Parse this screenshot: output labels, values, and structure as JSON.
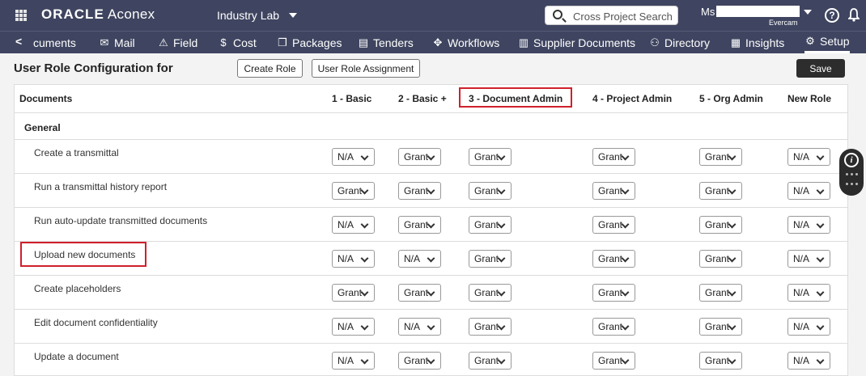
{
  "topbar": {
    "logo_brand": "ORACLE",
    "logo_product": "Aconex",
    "project": "Industry Lab",
    "search_placeholder": "Cross Project Search",
    "user_salutation": "Ms",
    "user_org": "Evercam",
    "help_label": "?"
  },
  "nav": {
    "items": [
      {
        "label": "cuments",
        "icon": "documents-icon"
      },
      {
        "label": "Mail",
        "icon": "mail-icon"
      },
      {
        "label": "Field",
        "icon": "field-icon"
      },
      {
        "label": "Cost",
        "icon": "cost-icon"
      },
      {
        "label": "Packages",
        "icon": "packages-icon"
      },
      {
        "label": "Tenders",
        "icon": "tenders-icon"
      },
      {
        "label": "Workflows",
        "icon": "workflows-icon"
      },
      {
        "label": "Supplier Documents",
        "icon": "supplier-documents-icon"
      },
      {
        "label": "Directory",
        "icon": "directory-icon"
      },
      {
        "label": "Insights",
        "icon": "insights-icon"
      },
      {
        "label": "Setup",
        "icon": "gear-icon"
      }
    ],
    "active": "Setup"
  },
  "page": {
    "title": "User Role Configuration for",
    "create_role": "Create Role",
    "user_role_assignment": "User Role Assignment",
    "save": "Save"
  },
  "table": {
    "section_header": "Documents",
    "columns": [
      "1 - Basic",
      "2 - Basic +",
      "3 - Document Admin",
      "4 - Project Admin",
      "5 - Org Admin",
      "New Role"
    ],
    "group": "General",
    "rows": [
      {
        "label": "Create a transmittal",
        "values": [
          "N/A",
          "Grant",
          "Grant",
          "Grant",
          "Grant",
          "N/A"
        ]
      },
      {
        "label": "Run a transmittal history report",
        "values": [
          "Grant",
          "Grant",
          "Grant",
          "Grant",
          "Grant",
          "N/A"
        ]
      },
      {
        "label": "Run auto-update transmitted documents",
        "values": [
          "N/A",
          "Grant",
          "Grant",
          "Grant",
          "Grant",
          "N/A"
        ]
      },
      {
        "label": "Upload new documents",
        "values": [
          "N/A",
          "N/A",
          "Grant",
          "Grant",
          "Grant",
          "N/A"
        ]
      },
      {
        "label": "Create placeholders",
        "values": [
          "Grant",
          "Grant",
          "Grant",
          "Grant",
          "Grant",
          "N/A"
        ]
      },
      {
        "label": "Edit document confidentiality",
        "values": [
          "N/A",
          "N/A",
          "Grant",
          "Grant",
          "Grant",
          "N/A"
        ]
      },
      {
        "label": "Update a document",
        "values": [
          "N/A",
          "Grant",
          "Grant",
          "Grant",
          "Grant",
          "N/A"
        ]
      }
    ]
  },
  "colors": {
    "header_bg": "#3f4560",
    "highlight": "#d0202c",
    "save_bg": "#2d2d2d"
  }
}
